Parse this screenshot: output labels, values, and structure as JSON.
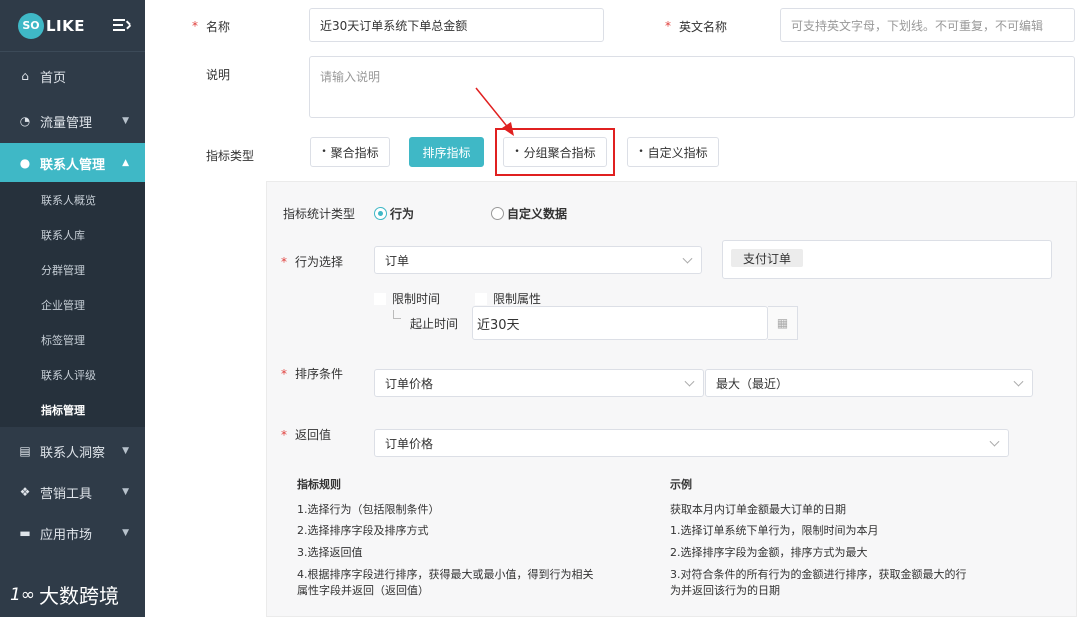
{
  "sidebar": {
    "logo_mark": "SO",
    "logo_text": "LIKE",
    "items": [
      {
        "label": "首页",
        "icon": "home-icon",
        "glyph": "⌂"
      },
      {
        "label": "流量管理",
        "icon": "pie-chart-icon",
        "glyph": "◔"
      },
      {
        "label": "联系人管理",
        "icon": "users-icon",
        "glyph": "👥"
      },
      {
        "label": "联系人洞察",
        "icon": "id-card-icon",
        "glyph": "▤"
      },
      {
        "label": "营销工具",
        "icon": "cubes-icon",
        "glyph": "❖"
      },
      {
        "label": "应用市场",
        "icon": "cart-icon",
        "glyph": "🛒"
      }
    ],
    "subitems": [
      "联系人概览",
      "联系人库",
      "分群管理",
      "企业管理",
      "标签管理",
      "联系人评级",
      "指标管理"
    ],
    "watermark": "大数跨境",
    "watermark_logo": "1∞"
  },
  "form": {
    "name_label": "名称",
    "name_value": "近30天订单系统下单总金额",
    "en_name_label": "英文名称",
    "en_name_placeholder": "可支持英文字母，下划线。不可重复，不可编辑",
    "desc_label": "说明",
    "desc_placeholder": "请输入说明",
    "type_label": "指标类型",
    "types": [
      "聚合指标",
      "排序指标",
      "分组聚合指标",
      "自定义指标"
    ]
  },
  "panel": {
    "stat_type_label": "指标统计类型",
    "radio_behavior": "行为",
    "radio_custom": "自定义数据",
    "behavior_label": "行为选择",
    "behavior_value": "订单",
    "behavior_tag": "支付订单",
    "limit_time": "限制时间",
    "limit_attr": "限制属性",
    "range_label": "起止时间",
    "range_value": "近30天",
    "sort_label": "排序条件",
    "sort_field": "订单价格",
    "sort_order": "最大（最近）",
    "return_label": "返回值",
    "return_value": "订单价格",
    "rules_title": "指标规则",
    "rules": [
      "1.选择行为（包括限制条件）",
      "2.选择排序字段及排序方式",
      "3.选择返回值",
      "4.根据排序字段进行排序，获得最大或最小值，得到行为相关",
      "属性字段并返回（返回值）"
    ],
    "example_title": "示例",
    "examples": [
      "获取本月内订单金额最大订单的日期",
      "1.选择订单系统下单行为，限制时间为本月",
      "2.选择排序字段为金额，排序方式为最大",
      "3.对符合条件的所有行为的金额进行排序，获取金额最大的行",
      "为并返回该行为的日期"
    ]
  }
}
